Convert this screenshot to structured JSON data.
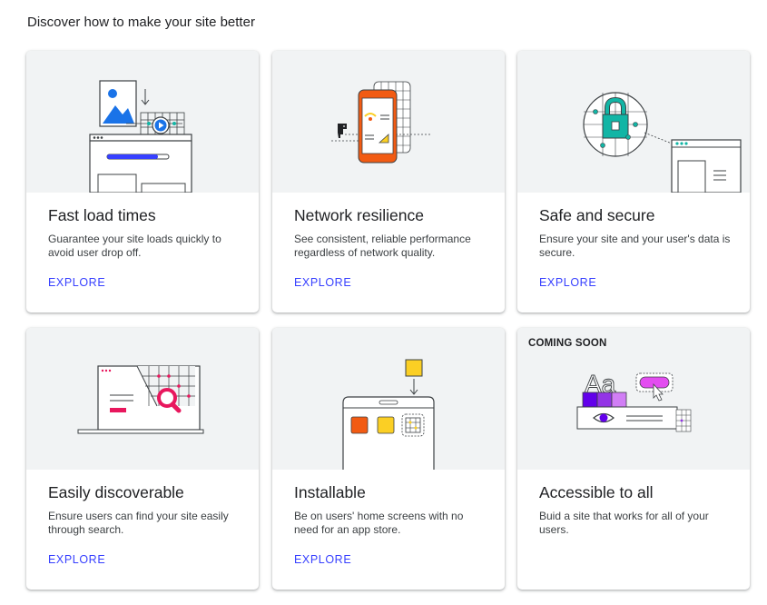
{
  "heading": "Discover how to make your site better",
  "cards": [
    {
      "title": "Fast load times",
      "description": "Guarantee your site loads quickly to avoid user drop off.",
      "link": "EXPLORE",
      "badge": ""
    },
    {
      "title": "Network resilience",
      "description": "See consistent, reliable performance regardless of network quality.",
      "link": "EXPLORE",
      "badge": ""
    },
    {
      "title": "Safe and secure",
      "description": "Ensure your site and your user's data is secure.",
      "link": "EXPLORE",
      "badge": ""
    },
    {
      "title": "Easily discoverable",
      "description": "Ensure users can find your site easily through search.",
      "link": "EXPLORE",
      "badge": ""
    },
    {
      "title": "Installable",
      "description": "Be on users' home screens with no need for an app store.",
      "link": "EXPLORE",
      "badge": ""
    },
    {
      "title": "Accessible to all",
      "description": "Buid a site that works for all of your users.",
      "link": "",
      "badge": "COMING SOON"
    }
  ],
  "illustration_text": {
    "accessible_aa": "Aa"
  },
  "colors": {
    "link": "#3740ff",
    "illustration_bg": "#f1f3f4",
    "accent_blue": "#1a73e8",
    "accent_orange": "#f25b13",
    "accent_teal": "#12b5a5",
    "accent_magenta": "#e8175d",
    "accent_yellow": "#fbcf24",
    "accent_purple": "#9334e6"
  }
}
